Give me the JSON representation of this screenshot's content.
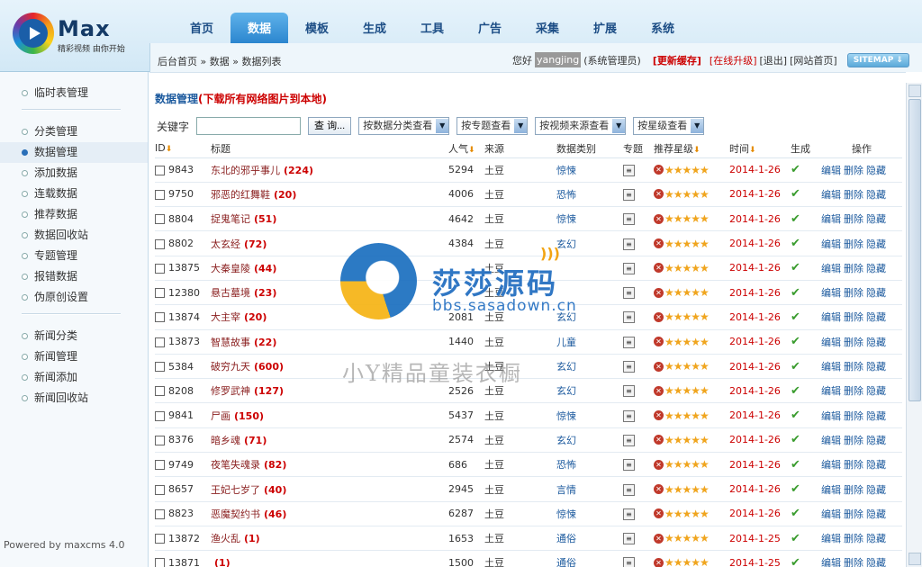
{
  "logo": {
    "word": "Max",
    "tagline": "精彩视频 由你开始"
  },
  "nav": [
    "首页",
    "数据",
    "模板",
    "生成",
    "工具",
    "广告",
    "采集",
    "扩展",
    "系统"
  ],
  "nav_active": 1,
  "breadcrumb": "后台首页 » 数据 » 数据列表",
  "user": {
    "hello": "您好",
    "name": "yangjing",
    "role": "(系统管理员)",
    "refresh": "[更新缓存]",
    "upgrade": "[在线升级]",
    "logout": "[退出]",
    "home": "[网站首页]",
    "sitemap": "SITEMAP ⇓"
  },
  "sidebar": {
    "groups": [
      [
        "临时表管理"
      ],
      [
        "分类管理",
        "数据管理",
        "添加数据",
        "连载数据",
        "推荐数据",
        "数据回收站",
        "专题管理",
        "报错数据",
        "伪原创设置"
      ],
      [
        "新闻分类",
        "新闻管理",
        "新闻添加",
        "新闻回收站"
      ]
    ],
    "active": "数据管理",
    "powered": "Powered by maxcms 4.0"
  },
  "pane": {
    "title": "数据管理",
    "title_link": "(下载所有网络图片到本地)"
  },
  "toolbar": {
    "keyword_label": "关键字",
    "search_btn": "查 询...",
    "selects": [
      "按数据分类查看",
      "按专题查看",
      "按视频来源查看",
      "按星级查看"
    ]
  },
  "columns": {
    "id": "ID",
    "title": "标题",
    "hits": "人气",
    "from": "来源",
    "cat": "数据类别",
    "topic": "专题",
    "star": "推荐星级",
    "time": "时间",
    "gen": "生成",
    "op": "操作"
  },
  "ops": [
    "编辑",
    "删除",
    "隐藏"
  ],
  "rows": [
    {
      "id": "9843",
      "title": "东北的邪乎事儿",
      "count": "(224)",
      "hits": "5294",
      "from": "土豆",
      "cat": "惊悚",
      "time": "2014-1-26"
    },
    {
      "id": "9750",
      "title": "邪恶的红舞鞋",
      "count": "(20)",
      "hits": "4006",
      "from": "土豆",
      "cat": "恐怖",
      "time": "2014-1-26"
    },
    {
      "id": "8804",
      "title": "捉鬼笔记",
      "count": "(51)",
      "hits": "4642",
      "from": "土豆",
      "cat": "惊悚",
      "time": "2014-1-26"
    },
    {
      "id": "8802",
      "title": "太玄经",
      "count": "(72)",
      "hits": "4384",
      "from": "土豆",
      "cat": "玄幻",
      "time": "2014-1-26"
    },
    {
      "id": "13875",
      "title": "大秦皇陵",
      "count": "(44)",
      "hits": "",
      "from": "土豆",
      "cat": "",
      "time": "2014-1-26"
    },
    {
      "id": "12380",
      "title": "悬古墓境",
      "count": "(23)",
      "hits": "",
      "from": "土豆",
      "cat": "",
      "time": "2014-1-26"
    },
    {
      "id": "13874",
      "title": "大主宰",
      "count": "(20)",
      "hits": "2081",
      "from": "土豆",
      "cat": "玄幻",
      "time": "2014-1-26"
    },
    {
      "id": "13873",
      "title": "智慧故事",
      "count": "(22)",
      "hits": "1440",
      "from": "土豆",
      "cat": "儿童",
      "time": "2014-1-26"
    },
    {
      "id": "5384",
      "title": "破穷九天",
      "count": "(600)",
      "hits": "",
      "from": "土豆",
      "cat": "玄幻",
      "time": "2014-1-26"
    },
    {
      "id": "8208",
      "title": "修罗武神",
      "count": "(127)",
      "hits": "2526",
      "from": "土豆",
      "cat": "玄幻",
      "time": "2014-1-26"
    },
    {
      "id": "9841",
      "title": "尸画",
      "count": "(150)",
      "hits": "5437",
      "from": "土豆",
      "cat": "惊悚",
      "time": "2014-1-26"
    },
    {
      "id": "8376",
      "title": "暗乡魂",
      "count": "(71)",
      "hits": "2574",
      "from": "土豆",
      "cat": "玄幻",
      "time": "2014-1-26"
    },
    {
      "id": "9749",
      "title": "夜笔失魂录",
      "count": "(82)",
      "hits": "686",
      "from": "土豆",
      "cat": "恐怖",
      "time": "2014-1-26"
    },
    {
      "id": "8657",
      "title": "王妃七岁了",
      "count": "(40)",
      "hits": "2945",
      "from": "土豆",
      "cat": "言情",
      "time": "2014-1-26"
    },
    {
      "id": "8823",
      "title": "恶魔契约书",
      "count": "(46)",
      "hits": "6287",
      "from": "土豆",
      "cat": "惊悚",
      "time": "2014-1-26"
    },
    {
      "id": "13872",
      "title": "渔火乱",
      "count": "(1)",
      "hits": "1653",
      "from": "土豆",
      "cat": "通俗",
      "time": "2014-1-25"
    },
    {
      "id": "13871",
      "title": "",
      "count": "(1)",
      "hits": "1500",
      "from": "土豆",
      "cat": "通俗",
      "time": "2014-1-25"
    }
  ],
  "watermark": {
    "brand": "莎莎源码",
    "url": "bbs.sasadown.cn",
    "shop": "小Y精品童装衣橱"
  }
}
